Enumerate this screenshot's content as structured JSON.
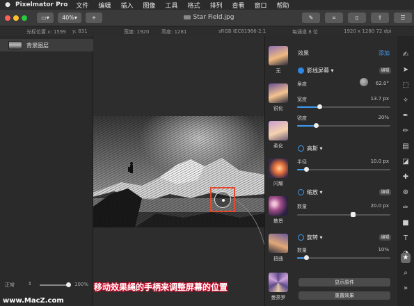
{
  "menubar": {
    "app_name": "Pixelmator Pro",
    "items": [
      "文件",
      "编辑",
      "插入",
      "图像",
      "工具",
      "格式",
      "排列",
      "查看",
      "窗口",
      "帮助"
    ]
  },
  "toolbar": {
    "zoom": "40%",
    "add": "+",
    "title": "Star Field.jpg"
  },
  "infobar": {
    "cursor": "光标位置 x: 1599",
    "cursor_y": "y: 831",
    "width": "宽度: 1920",
    "height": "高度: 1281",
    "profile": "sRGB IEC61966-2.1",
    "depth": "每通道 8 位",
    "size": "1920 x 1280 72 dpi"
  },
  "layers": {
    "items": [
      {
        "name": "背景图层"
      }
    ],
    "blend_mode": "正常",
    "opacity": "100%",
    "opacity_value": 1.0
  },
  "effects": {
    "header": "效果",
    "add_label": "添加",
    "presets": [
      {
        "label": "无"
      },
      {
        "label": "锐化"
      },
      {
        "label": "柔化"
      },
      {
        "label": "闪耀"
      },
      {
        "label": "散景"
      },
      {
        "label": "扭曲"
      },
      {
        "label": "曼荼罗"
      }
    ],
    "edit_label": "编辑",
    "halftone": {
      "name": "影线屏幕",
      "angle_label": "角度",
      "angle_value": "62.0°",
      "width_label": "宽度",
      "width_value": "13.7 px",
      "width_fraction": 0.24,
      "sharp_label": "锐度",
      "sharp_value": "20%",
      "sharp_fraction": 0.2
    },
    "gaussian": {
      "name": "高斯",
      "radius_label": "半径",
      "radius_value": "10.0 px",
      "radius_fraction": 0.1
    },
    "zoom": {
      "name": "缩放",
      "amount_label": "数量",
      "amount_value": "20.0 px",
      "amount_fraction": 0.6
    },
    "spin": {
      "name": "旋转",
      "amount_label": "数量",
      "amount_value": "10%",
      "amount_fraction": 0.1
    },
    "show_original": "显示原件",
    "reset": "重置效果"
  },
  "caption": "移动效果绳的手柄来调整屏幕的位置",
  "watermark": "www.MacZ.com"
}
